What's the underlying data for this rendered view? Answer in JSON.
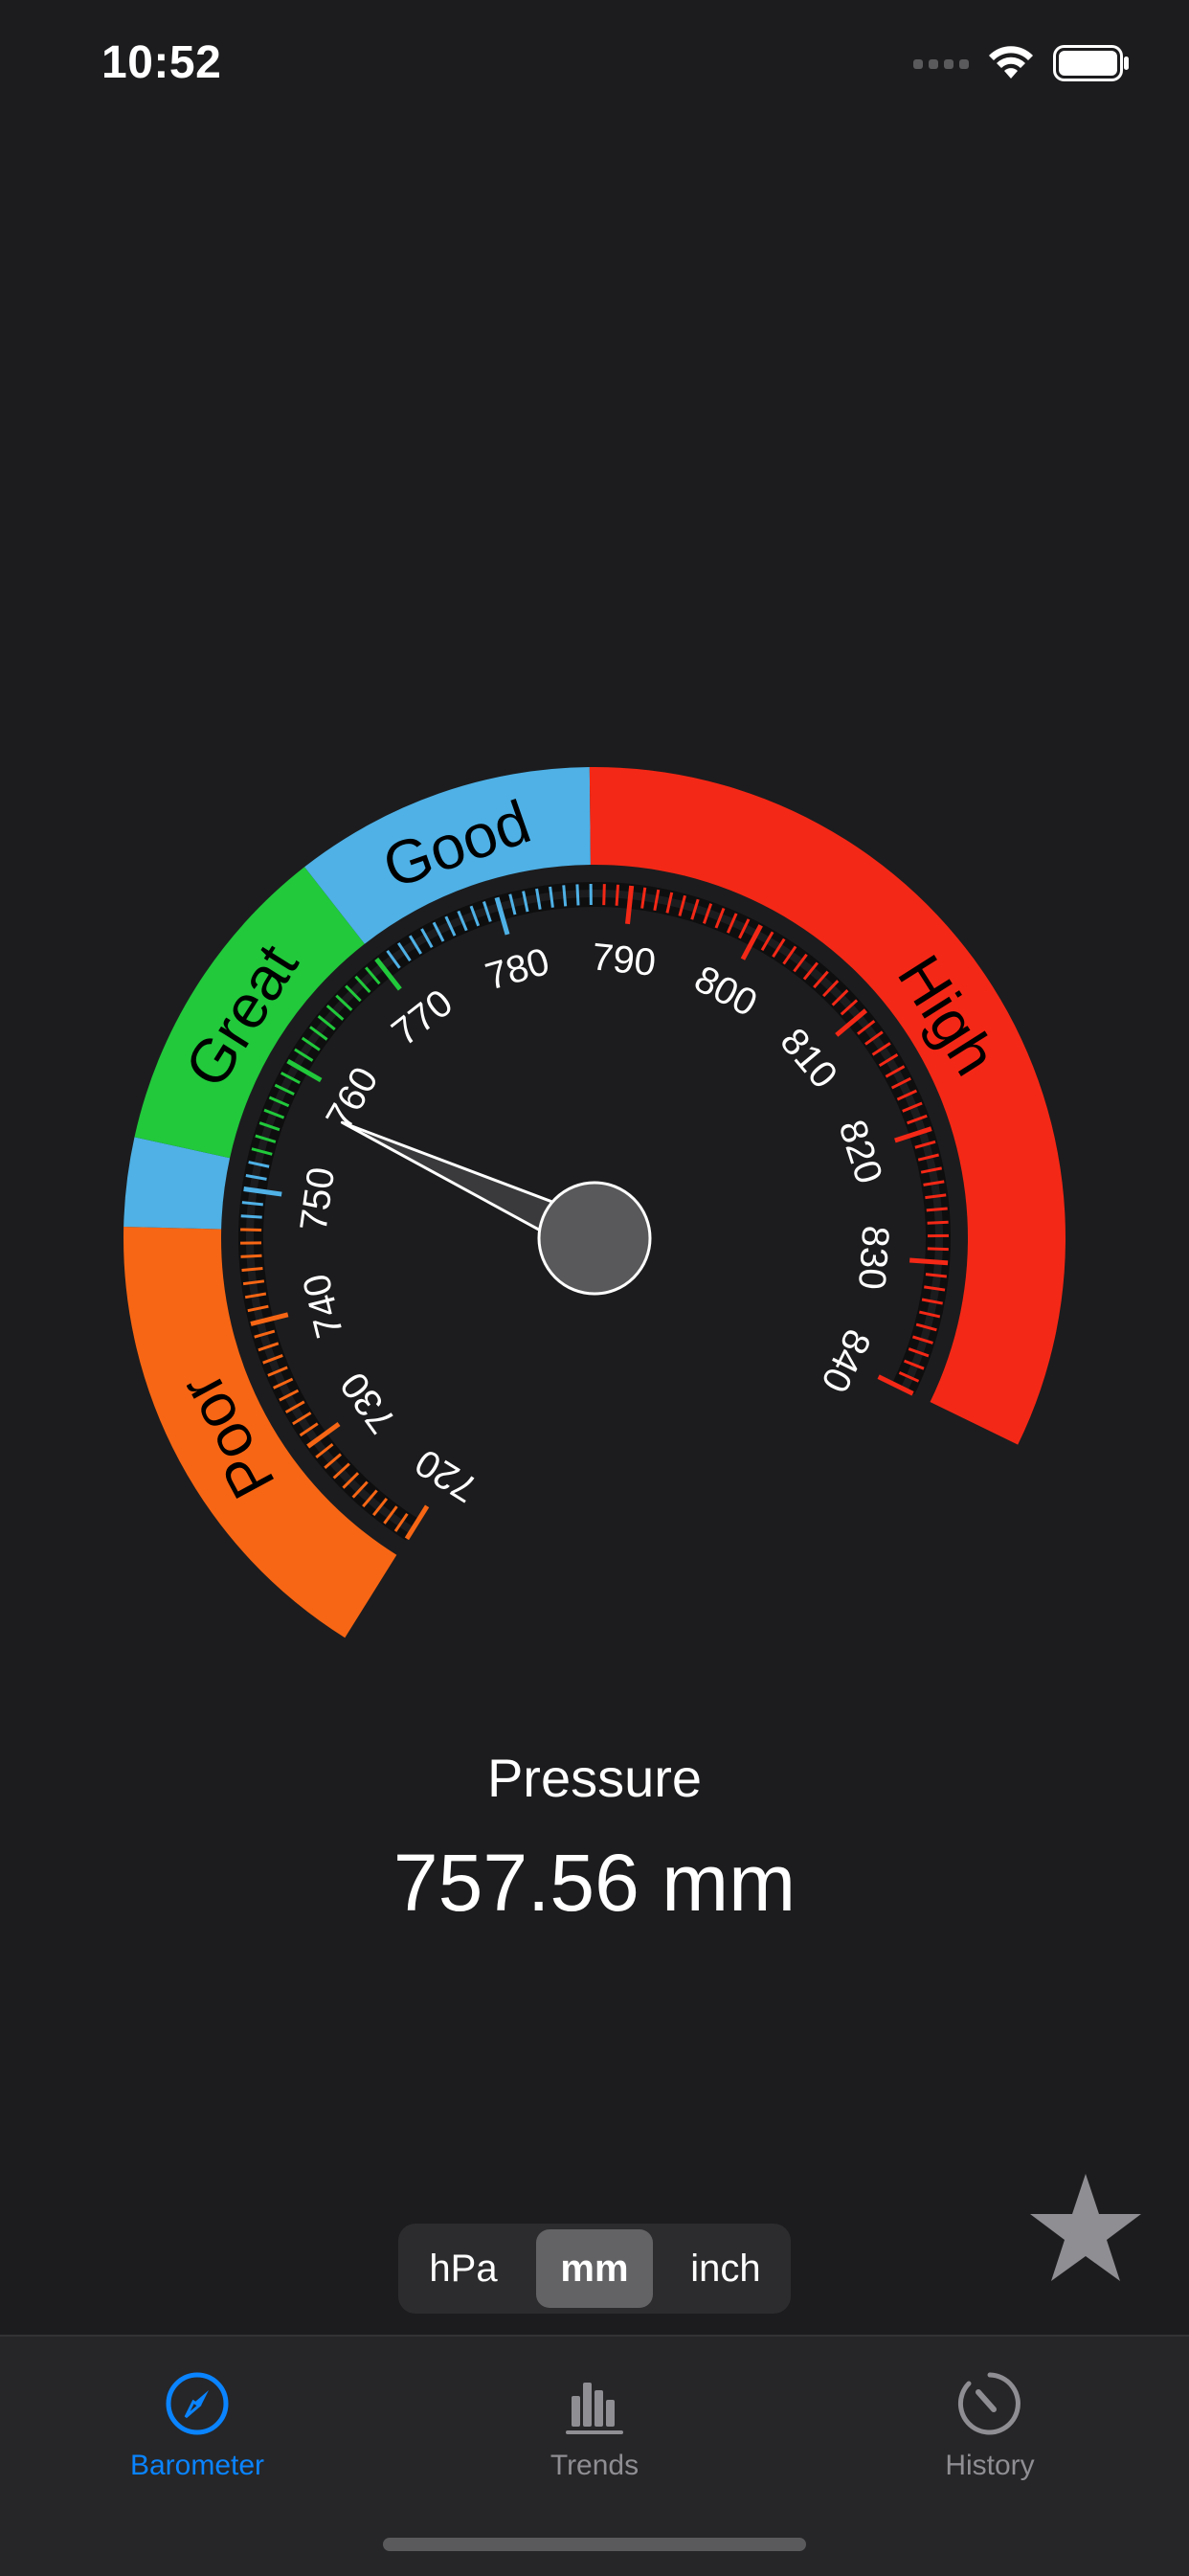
{
  "status_bar": {
    "time": "10:52",
    "icons": [
      "signal-dots-icon",
      "wifi-icon",
      "battery-icon"
    ]
  },
  "gauge": {
    "unit": "mm",
    "min": 720,
    "max": 840,
    "major_ticks": [
      720,
      730,
      740,
      750,
      760,
      770,
      780,
      790,
      800,
      810,
      820,
      830,
      840
    ],
    "tick_labels": [
      "720",
      "730",
      "740",
      "750",
      "760",
      "770",
      "780",
      "790",
      "800",
      "810",
      "820",
      "830",
      "840"
    ],
    "needle_value": 757.56,
    "zones": [
      {
        "label": "Poor",
        "from": 720,
        "to": 747,
        "color": "#f76614"
      },
      {
        "label": "",
        "from": 747,
        "to": 752,
        "color": "#4fb1e6"
      },
      {
        "label": "Great",
        "from": 752,
        "to": 770,
        "color": "#21c93b"
      },
      {
        "label": "Good",
        "from": 770,
        "to": 787,
        "color": "#4fb1e6"
      },
      {
        "label": "High",
        "from": 787,
        "to": 840,
        "color": "#f42816"
      }
    ],
    "colors": {
      "background": "#1c1c1e",
      "needle_fill": "#3a3a3c",
      "hub_fill": "#59595b",
      "needle_stroke": "#ffffff",
      "zone_text": "#000000",
      "tick_text": "#ffffff"
    }
  },
  "readout": {
    "label": "Pressure",
    "value": "757.56 mm"
  },
  "units": {
    "options": [
      "hPa",
      "mm",
      "inch"
    ],
    "selected": "mm"
  },
  "favorite": {
    "icon": "star-icon"
  },
  "tab_bar": {
    "tabs": [
      {
        "label": "Barometer",
        "icon": "compass-icon",
        "active": true
      },
      {
        "label": "Trends",
        "icon": "bar-chart-icon",
        "active": false
      },
      {
        "label": "History",
        "icon": "history-dial-icon",
        "active": false
      }
    ],
    "active_color": "#0a84ff",
    "inactive_color": "#8e8e93"
  }
}
